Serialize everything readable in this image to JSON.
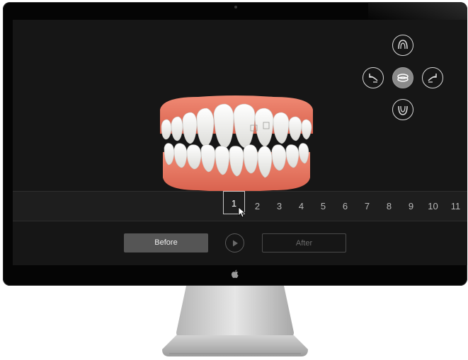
{
  "viewer": {
    "view_controls": [
      {
        "name": "upper-arch-view",
        "icon": "upper-arch-icon",
        "active": false
      },
      {
        "name": "rotate-left-view",
        "icon": "rotate-left-icon",
        "active": false
      },
      {
        "name": "frontal-view",
        "icon": "frontal-view-icon",
        "active": true
      },
      {
        "name": "rotate-right-view",
        "icon": "rotate-right-icon",
        "active": false
      },
      {
        "name": "lower-arch-view",
        "icon": "lower-arch-icon",
        "active": false
      }
    ]
  },
  "timeline": {
    "selected_stage": "1",
    "stages": [
      "1",
      "2",
      "3",
      "4",
      "5",
      "6",
      "7",
      "8",
      "9",
      "10",
      "11"
    ]
  },
  "controls": {
    "before_label": "Before",
    "after_label": "After",
    "play_icon": "play-icon"
  },
  "colors": {
    "gum": "#e8735e",
    "tooth": "#f4f4f2",
    "active_control": "#8a8a8a"
  }
}
